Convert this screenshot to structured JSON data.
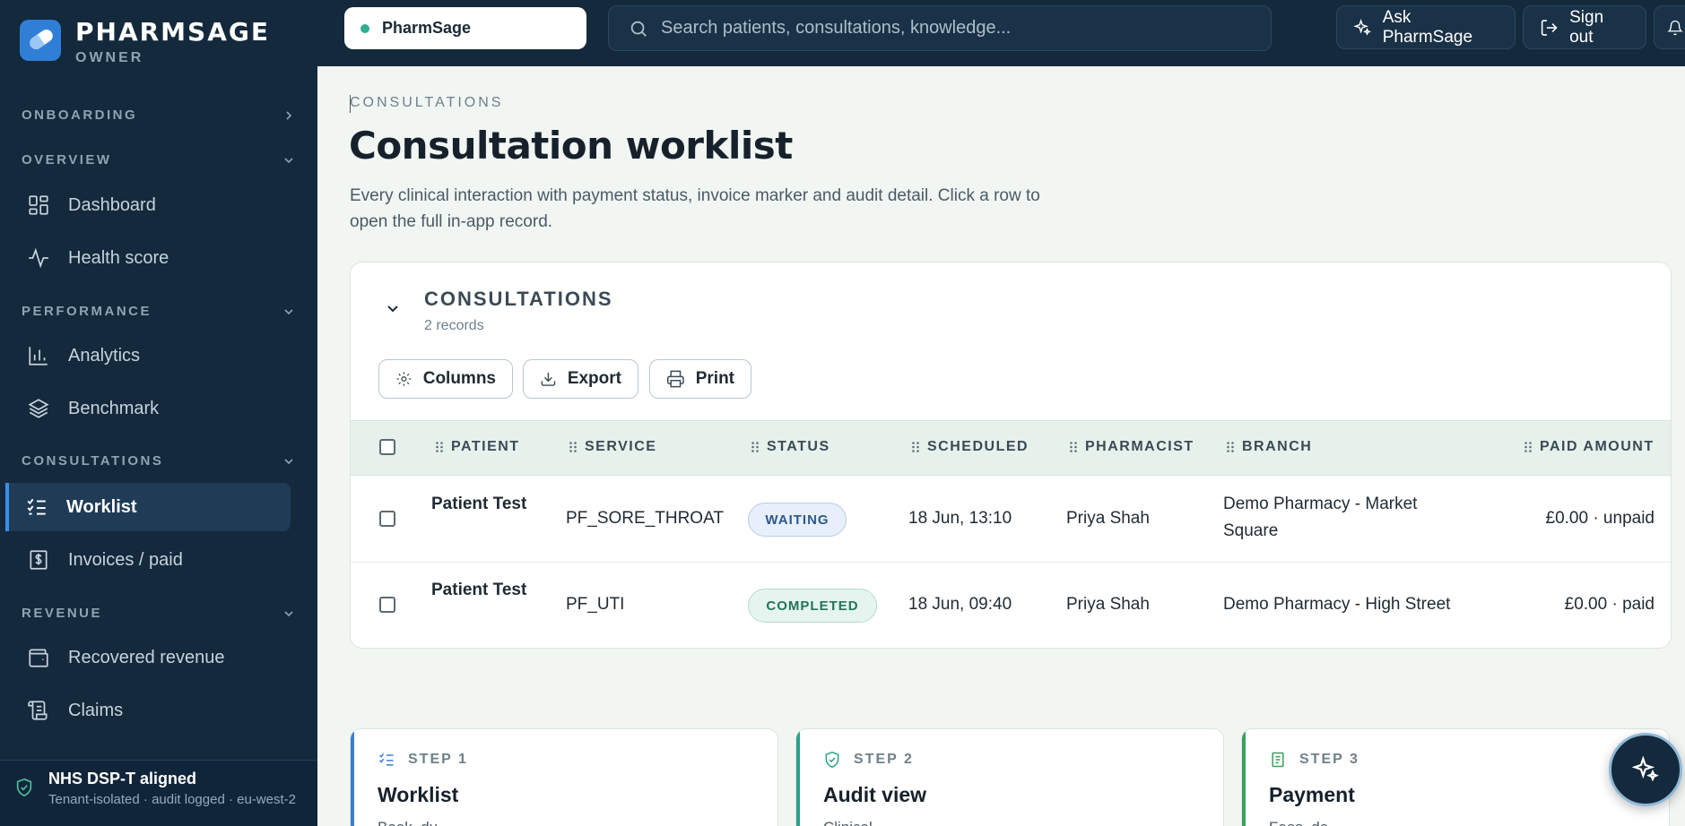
{
  "brand": {
    "name": "PHARMSAGE",
    "role": "OWNER"
  },
  "sidebar": {
    "sections": {
      "onboarding": "ONBOARDING",
      "overview": "OVERVIEW",
      "performance": "PERFORMANCE",
      "consultations": "CONSULTATIONS",
      "revenue": "REVENUE"
    },
    "items": {
      "dashboard": "Dashboard",
      "health": "Health score",
      "analytics": "Analytics",
      "benchmark": "Benchmark",
      "worklist": "Worklist",
      "invoices": "Invoices / paid",
      "recovered": "Recovered revenue",
      "claims": "Claims"
    },
    "footer": {
      "title": "NHS DSP-T aligned",
      "subtitle": "Tenant-isolated · audit logged · eu-west-2"
    }
  },
  "topbar": {
    "tenant": "PharmSage",
    "search_placeholder": "Search patients, consultations, knowledge...",
    "ask": "Ask PharmSage",
    "signout": "Sign out"
  },
  "page": {
    "eyebrow": "CONSULTATIONS",
    "title": "Consultation worklist",
    "description": "Every clinical interaction with payment status, invoice marker and audit detail. Click a row to open the full in-app record."
  },
  "card": {
    "title": "CONSULTATIONS",
    "count": "2 records",
    "tools": {
      "columns": "Columns",
      "export": "Export",
      "print": "Print"
    },
    "columns": {
      "patient": "PATIENT",
      "service": "SERVICE",
      "status": "STATUS",
      "scheduled": "SCHEDULED",
      "pharmacist": "PHARMACIST",
      "branch": "BRANCH",
      "paid": "PAID AMOUNT"
    },
    "rows": [
      {
        "patient": "Patient Test",
        "service": "PF_SORE_THROAT",
        "status": "WAITING",
        "scheduled": "18 Jun, 13:10",
        "pharmacist": "Priya Shah",
        "branch": "Demo Pharmacy - Market Square",
        "paid": "£0.00 · unpaid"
      },
      {
        "patient": "Patient Test",
        "service": "PF_UTI",
        "status": "COMPLETED",
        "scheduled": "18 Jun, 09:40",
        "pharmacist": "Priya Shah",
        "branch": "Demo Pharmacy - High Street",
        "paid": "£0.00 · paid"
      }
    ]
  },
  "steps": [
    {
      "label": "STEP 1",
      "title": "Worklist",
      "desc": "Book, du..",
      "color": "#3b7fcf"
    },
    {
      "label": "STEP 2",
      "title": "Audit view",
      "desc": "Clinical...",
      "color": "#2fa088"
    },
    {
      "label": "STEP 3",
      "title": "Payment",
      "desc": "Fees, de...",
      "color": "#3aa05a"
    }
  ],
  "colors": {
    "sidebar": "#14293b",
    "accent": "#3b8ee8",
    "page_bg": "#f1f6f3"
  }
}
